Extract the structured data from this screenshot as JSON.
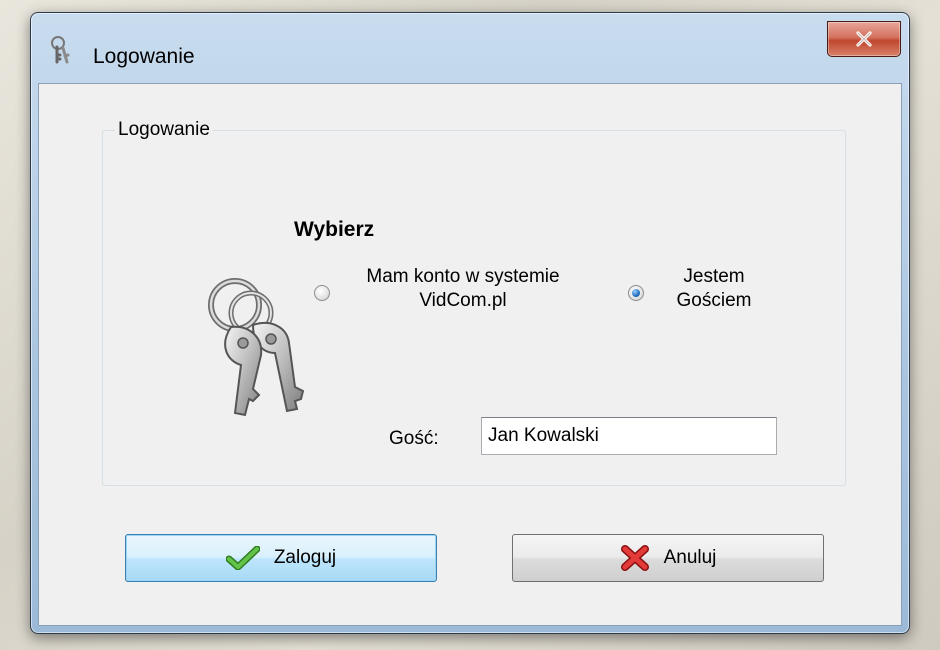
{
  "window": {
    "title": "Logowanie",
    "close_glyph": "✕"
  },
  "group": {
    "legend": "Logowanie",
    "heading": "Wybierz"
  },
  "radios": [
    {
      "label_line1": "Mam konto w systemie",
      "label_line2": "VidCom.pl",
      "checked": false
    },
    {
      "label_line1": "Jestem",
      "label_line2": "Gościem",
      "checked": true
    }
  ],
  "guest": {
    "label": "Gość:",
    "value": "Jan Kowalski"
  },
  "buttons": {
    "login_label": "Zaloguj",
    "login_icon": "checkmark-icon",
    "cancel_label": "Anuluj",
    "cancel_icon": "red-x-icon"
  },
  "colors": {
    "close_button": "#c84a32",
    "check_green": "#3fa62a",
    "cancel_red": "#d42020",
    "default_button_border": "#3c7fb1"
  }
}
